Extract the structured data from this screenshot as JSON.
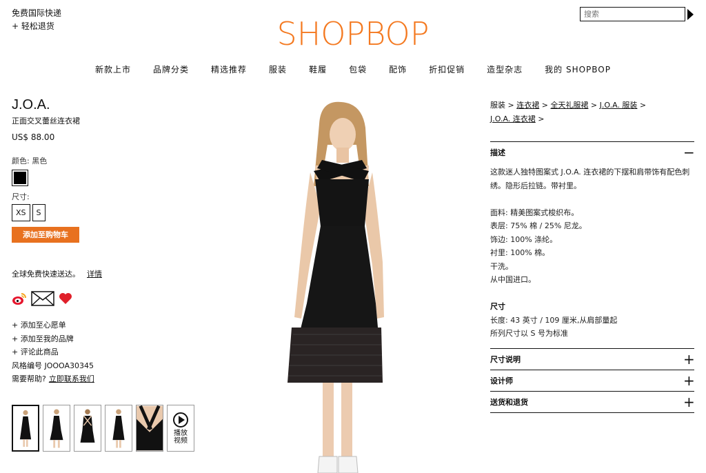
{
  "header": {
    "promo": [
      "免费国际快递",
      "+ 轻松退货"
    ],
    "logo": "SHOPBOP",
    "search_placeholder": "搜索",
    "nav": [
      "新款上市",
      "品牌分类",
      "精选推荐",
      "服装",
      "鞋履",
      "包袋",
      "配饰",
      "折扣促销",
      "造型杂志",
      "我的 SHOPBOP"
    ]
  },
  "product": {
    "brand": "J.O.A.",
    "name": "正面交叉蕾丝连衣裙",
    "price": "US$ 88.00",
    "color_label": "颜色:  黑色",
    "color_swatch": "#000000",
    "size_label": "尺寸:",
    "sizes": [
      "XS",
      "S"
    ],
    "add_to_cart": "添加至购物车",
    "shipping": "全球免费快速送达。",
    "shipping_link": "详情",
    "links": [
      "+ 添加至心愿单",
      "+ 添加至我的品牌",
      "+ 评论此商品"
    ],
    "style_no": "风格编号 JOOOA30345",
    "help": "需要帮助?",
    "help_link": "立即联系我们",
    "video_label": "播放视频",
    "heart_color": "#e0202a",
    "accent": "#f47920"
  },
  "breadcrumb": {
    "items": [
      "服装",
      "连衣裙",
      "全天礼服裙",
      "J.O.A. 服装",
      "J.O.A. 连衣裙"
    ],
    "sep": " >"
  },
  "details": {
    "desc_title": "描述",
    "desc_text": "这款迷人独特图案式 J.O.A. 连衣裙的下摆和肩带饰有配色刺绣。隐形后拉链。带衬里。",
    "materials": [
      "面料: 精美图案式梭织布。",
      "表层: 75% 棉 / 25% 尼龙。",
      "饰边: 100% 涤纶。",
      "衬里: 100% 棉。",
      "干洗。",
      "从中国进口。"
    ],
    "size_title": "尺寸",
    "size_lines": [
      "长度: 43 英寸 / 109 厘米,从肩部量起",
      "所列尺寸以 S 号为标准"
    ],
    "sections": [
      "尺寸说明",
      "设计师",
      "送货和退货"
    ],
    "minus": "−",
    "plus": "+"
  }
}
